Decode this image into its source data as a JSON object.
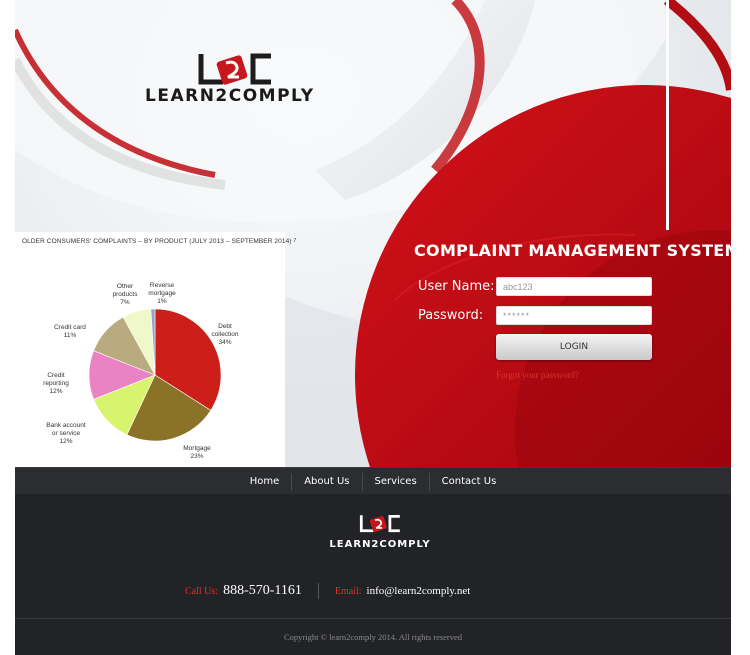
{
  "brand": {
    "name": "LEARN2COMPLY",
    "mark": "L2C"
  },
  "login": {
    "title": "COMPLAINT MANAGEMENT SYSTEM",
    "username_label": "User Name:",
    "username_value": "abc123",
    "password_label": "Password:",
    "password_value": "******",
    "button_label": "LOGIN",
    "forgot_label": "Forgot your password?"
  },
  "nav": {
    "items": [
      {
        "label": "Home"
      },
      {
        "label": "About Us"
      },
      {
        "label": "Services"
      },
      {
        "label": "Contact Us"
      }
    ]
  },
  "footer": {
    "call_label": "Call Us:",
    "phone": "888-570-1161",
    "email_label": "Email:",
    "email": "info@learn2comply.net",
    "copyright": "Copyright © learn2comply 2014. All rights reserved"
  },
  "colors": {
    "accent_red": "#c0151b",
    "dark": "#222326",
    "nav": "#2c2d30"
  },
  "chart_data": {
    "type": "pie",
    "title": "OLDER CONSUMERS' COMPLAINTS – BY PRODUCT  (JULY 2013 – SEPTEMBER 2014)",
    "title_mark": "7",
    "slices": [
      {
        "name_lines": [
          "Debt",
          "collection"
        ],
        "pct_label": "34%",
        "value": 34,
        "color": "#cc1f1a"
      },
      {
        "name_lines": [
          "Mortgage"
        ],
        "pct_label": "23%",
        "value": 23,
        "color": "#8a7326"
      },
      {
        "name_lines": [
          "Bank account",
          "or service"
        ],
        "pct_label": "12%",
        "value": 12,
        "color": "#d8f46e"
      },
      {
        "name_lines": [
          "Credit",
          "reporting"
        ],
        "pct_label": "12%",
        "value": 12,
        "color": "#ea83c4"
      },
      {
        "name_lines": [
          "Credit card"
        ],
        "pct_label": "11%",
        "value": 11,
        "color": "#b9aa7f"
      },
      {
        "name_lines": [
          "Other",
          "products"
        ],
        "pct_label": "7%",
        "value": 7,
        "color": "#f0f7c8"
      },
      {
        "name_lines": [
          "Reverse",
          "mortgage"
        ],
        "pct_label": "1%",
        "value": 1,
        "color": "#9aa3c4"
      }
    ]
  }
}
